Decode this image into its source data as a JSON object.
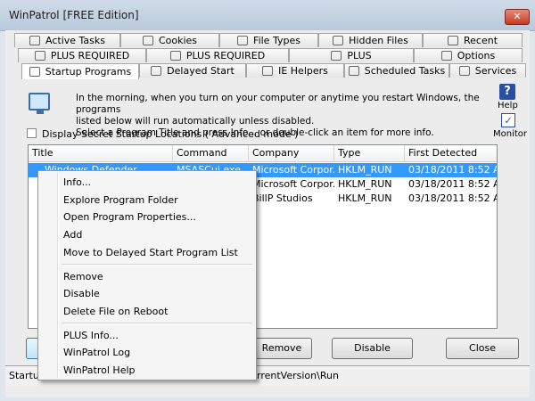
{
  "window": {
    "title": "WinPatrol [FREE Edition]",
    "close_glyph": "✕"
  },
  "tabs_row1": [
    {
      "label": "Active Tasks",
      "icon": "tasks-icon"
    },
    {
      "label": "Cookies",
      "icon": "cookie-icon"
    },
    {
      "label": "File Types",
      "icon": "filetypes-icon"
    },
    {
      "label": "Hidden Files",
      "icon": "hidden-files-icon"
    },
    {
      "label": "Recent",
      "icon": "recent-icon"
    }
  ],
  "tabs_row2": [
    {
      "label": "PLUS REQUIRED",
      "icon": "plus-icon"
    },
    {
      "label": "PLUS REQUIRED",
      "icon": "plus-icon"
    },
    {
      "label": "PLUS",
      "icon": "plus-icon"
    },
    {
      "label": "Options",
      "icon": "options-icon"
    }
  ],
  "tabs_row3": [
    {
      "label": "Startup Programs",
      "icon": "startup-icon",
      "active": true
    },
    {
      "label": "Delayed Start",
      "icon": "delayed-icon"
    },
    {
      "label": "IE Helpers",
      "icon": "ie-icon"
    },
    {
      "label": "Scheduled Tasks",
      "icon": "scheduled-icon"
    },
    {
      "label": "Services",
      "icon": "services-icon"
    }
  ],
  "description": {
    "line1": "In  the  morning,  when you turn on your computer or anytime you restart Windows, the programs",
    "line2": "listed below will run automatically unless disabled.",
    "line3": "Select a Program Title and press Info... or double-click an item for more info."
  },
  "side": {
    "help_glyph": "?",
    "help_label": "Help",
    "monitor_glyph": "✓",
    "monitor_label": "Monitor"
  },
  "secret": {
    "label": "Display Secret Startup Locations  ( Advanced mode )"
  },
  "list": {
    "columns": [
      "Title",
      "Command",
      "Company",
      "Type",
      "First Detected"
    ],
    "rows": [
      {
        "title": "Windows Defender",
        "command": "MSASCui.exe",
        "company": "Microsoft Corpor...",
        "type": "HKLM_RUN",
        "detected": "03/18/2011 8:52 AM",
        "selected": true
      },
      {
        "title": "",
        "command": "",
        "company": "Microsoft Corpor...",
        "type": "HKLM_RUN",
        "detected": "03/18/2011 8:52 AM"
      },
      {
        "title": "",
        "command": "",
        "company": "BillP Studios",
        "type": "HKLM_RUN",
        "detected": "03/18/2011 8:52 AM"
      }
    ]
  },
  "buttons": {
    "remove": "Remove",
    "disable": "Disable",
    "close": "Close"
  },
  "status": {
    "left": "Startu",
    "right": "rrentVersion\\Run"
  },
  "context_menu": {
    "items": [
      "Info...",
      "Explore Program Folder",
      "Open Program Properties...",
      "Add",
      "Move to Delayed Start Program List",
      "Remove",
      "Disable",
      "Delete File on Reboot",
      "PLUS Info...",
      "WinPatrol Log",
      "WinPatrol Help"
    ]
  }
}
